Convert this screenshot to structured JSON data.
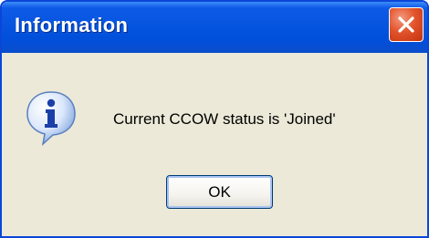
{
  "dialog": {
    "title": "Information",
    "message": "Current CCOW status is 'Joined'",
    "ok_label": "OK"
  },
  "icons": {
    "info": "info-icon",
    "close": "close-icon"
  },
  "colors": {
    "title_bar": "#0756e0",
    "body": "#ece9d8",
    "close_button": "#e2542c",
    "border": "#0b46d8"
  }
}
